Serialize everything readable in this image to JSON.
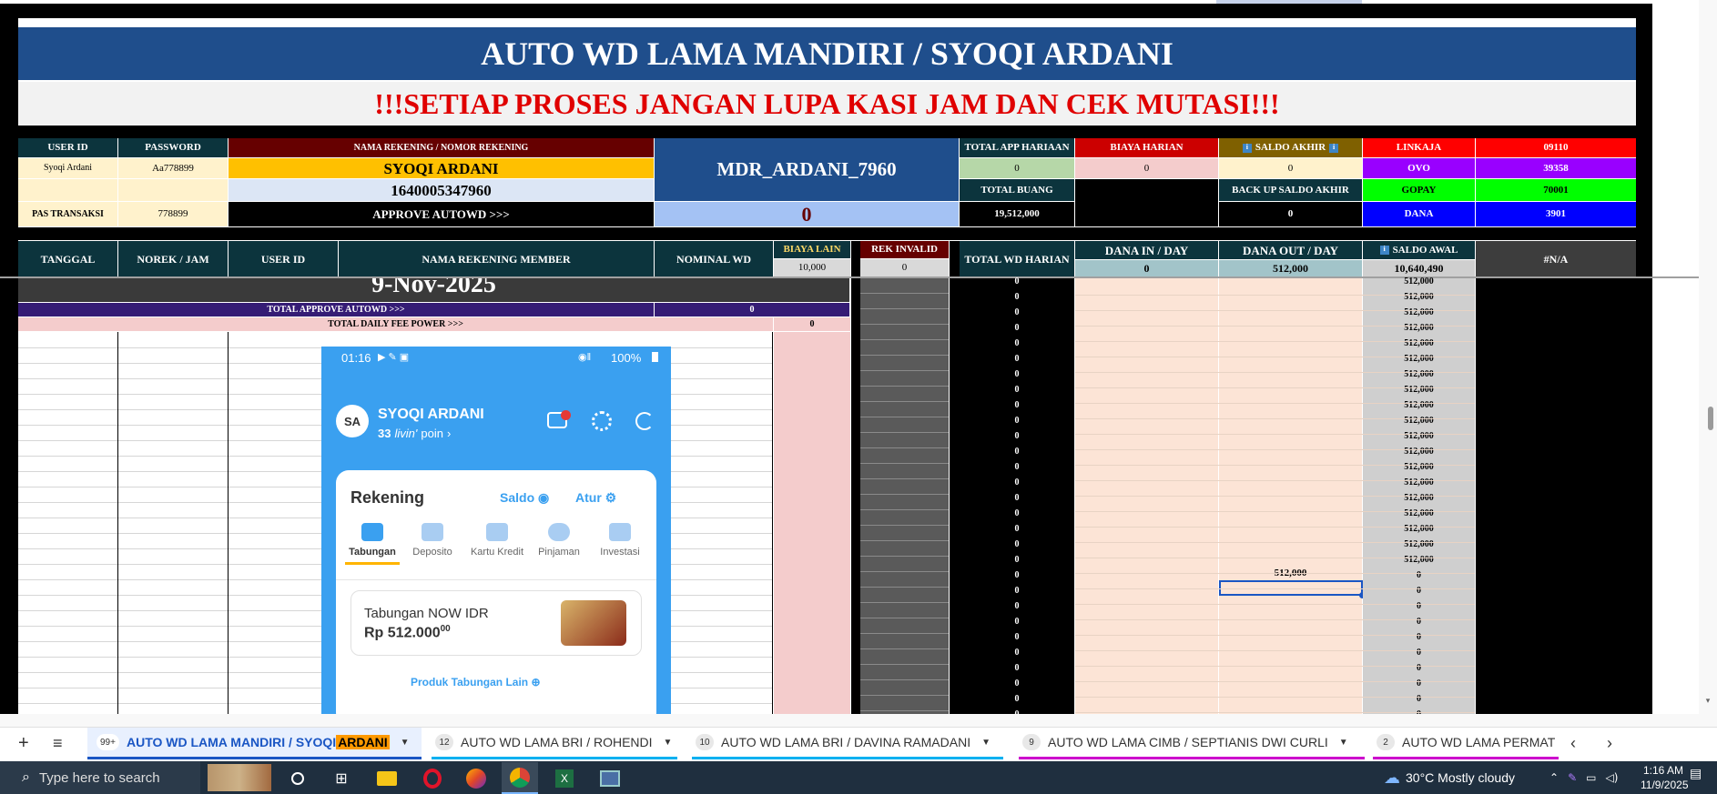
{
  "header": {
    "title": "AUTO WD LAMA MANDIRI / SYOQI ARDANI",
    "warning": "!!!SETIAP PROSES JANGAN LUPA KASI JAM DAN CEK MUTASI!!!"
  },
  "info": {
    "user_id_h": "USER ID",
    "password_h": "PASSWORD",
    "nama_rek_h": "NAMA REKENING / NOMOR REKENING",
    "user_id": "Syoqi Ardani",
    "password": "Aa778899",
    "nama": "SYOQI ARDANI",
    "nomor": "1640005347960",
    "pas_label": "PAS TRANSAKSI",
    "pas_value": "778899",
    "approve_label": "APPROVE AUTOWD >>>",
    "approve_value": "0",
    "account_code": "MDR_ARDANI_7960",
    "total_app_h": "TOTAL APP HARIAAN",
    "total_app": "0",
    "biaya_harian_h": "BIAYA HARIAN",
    "biaya_harian": "0",
    "saldo_akhir_h": "SALDO AKHIR",
    "saldo_akhir": "0",
    "total_buang_h": "TOTAL BUANG",
    "total_buang": "19,512,000",
    "backup_h": "BACK UP SALDO AKHIR",
    "backup": "0",
    "ewallets": [
      {
        "name": "LINKAJA",
        "value": "09110",
        "color": "#ff0000"
      },
      {
        "name": "OVO",
        "value": "39358",
        "color": "#9900ff"
      },
      {
        "name": "GOPAY",
        "value": "70001",
        "color": "#00ff00"
      },
      {
        "name": "DANA",
        "value": "3901",
        "color": "#0000ff"
      }
    ]
  },
  "columns": {
    "tanggal": "TANGGAL",
    "norek": "NOREK / JAM",
    "user_id": "USER ID",
    "nama_member": "NAMA REKENING MEMBER",
    "nominal": "NOMINAL WD",
    "biaya_lain_h": "BIAYA LAIN",
    "biaya_lain": "10,000",
    "rek_invalid_h": "REK INVALID",
    "rek_invalid": "0",
    "total_wd": "TOTAL WD HARIAN",
    "dana_in_h": "DANA IN / DAY",
    "dana_in": "0",
    "dana_out_h": "DANA OUT / DAY",
    "dana_out": "512,000",
    "saldo_awal_h": "SALDO AWAL",
    "saldo_awal": "10,640,490",
    "na": "#N/A"
  },
  "body": {
    "date": "9-Nov-2025",
    "total_approve_label": "TOTAL APPROVE AUTOWD >>>",
    "total_approve_value": "0",
    "daily_fee_label": "TOTAL DAILY FEE POWER >>>",
    "daily_fee_value": "0",
    "dana_out_cell": "512,000",
    "saldo_rows": [
      "512,000",
      "512,000",
      "512,000",
      "512,000",
      "512,000",
      "512,000",
      "512,000",
      "512,000",
      "512,000",
      "512,000",
      "512,000",
      "512,000",
      "512,000",
      "512,000",
      "512,000",
      "512,000",
      "512,000",
      "512,000",
      "512,000",
      "0",
      "0",
      "0",
      "0",
      "0",
      "0",
      "0",
      "0",
      "0",
      "0"
    ],
    "total_wd_rows": [
      "0",
      "0",
      "0",
      "0",
      "0",
      "0",
      "0",
      "0",
      "0",
      "0",
      "0",
      "0",
      "0",
      "0",
      "0",
      "0",
      "0",
      "0",
      "0",
      "0",
      "0",
      "0",
      "0",
      "0",
      "0",
      "0",
      "0",
      "0",
      "0"
    ]
  },
  "phone": {
    "time": "01:16",
    "battery": "100%",
    "avatar": "SA",
    "name": "SYOQI ARDANI",
    "points": "33",
    "points_brand": "livin'",
    "points_suffix": "poin",
    "rekening": "Rekening",
    "saldo": "Saldo",
    "atur": "Atur",
    "tabs": [
      "Tabungan",
      "Deposito",
      "Kartu Kredit",
      "Pinjaman",
      "Investasi"
    ],
    "account_name": "Tabungan NOW IDR",
    "balance": "Rp 512.000",
    "balance_cents": "00",
    "produk": "Produk Tabungan Lain"
  },
  "sheet_tabs": [
    {
      "count": "99+",
      "label_a": "AUTO WD LAMA MANDIRI / SYOQI ",
      "label_b": "ARDANI",
      "active": true
    },
    {
      "count": "12",
      "label_a": "AUTO WD LAMA BRI / ROHENDI",
      "active": false
    },
    {
      "count": "10",
      "label_a": "AUTO WD LAMA BRI / DAVINA  RAMADANI",
      "active": false
    },
    {
      "count": "9",
      "label_a": "AUTO WD LAMA CIMB / SEPTIANIS DWI CURLI",
      "active": false
    },
    {
      "count": "2",
      "label_a": "AUTO WD LAMA PERMAT",
      "active": false
    }
  ],
  "taskbar": {
    "search_placeholder": "Type here to search",
    "weather": "30°C  Mostly cloudy",
    "time": "1:16 AM",
    "date": "11/9/2025"
  },
  "colors": {
    "title_bg": "#1f4e8c",
    "dark_teal": "#0c343d",
    "maroon": "#660000",
    "gold": "#ffc000",
    "phone_blue": "#3aa0f0",
    "taskbar_bg": "#1f2f3f",
    "active_tab_blue": "#1a56c4"
  }
}
